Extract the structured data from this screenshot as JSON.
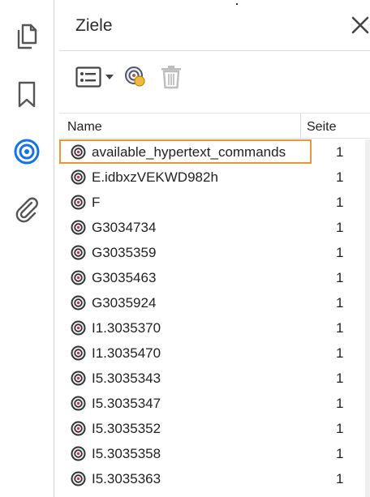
{
  "panel": {
    "title": "Ziele"
  },
  "rail": {
    "items": [
      {
        "icon": "pages-icon"
      },
      {
        "icon": "bookmark-icon"
      },
      {
        "icon": "destinations-icon",
        "active": true
      },
      {
        "icon": "attachment-icon"
      }
    ],
    "accent": "#1473e6"
  },
  "list": {
    "col_name": "Name",
    "col_page": "Seite",
    "rows": [
      {
        "name": "available_hypertext_commands",
        "page": "1"
      },
      {
        "name": "E.idbxzVEKWD982h",
        "page": "1"
      },
      {
        "name": "F",
        "page": "1"
      },
      {
        "name": "G3034734",
        "page": "1"
      },
      {
        "name": "G3035359",
        "page": "1"
      },
      {
        "name": "G3035463",
        "page": "1"
      },
      {
        "name": "G3035924",
        "page": "1"
      },
      {
        "name": "I1.3035370",
        "page": "1"
      },
      {
        "name": "I1.3035470",
        "page": "1"
      },
      {
        "name": "I5.3035343",
        "page": "1"
      },
      {
        "name": "I5.3035347",
        "page": "1"
      },
      {
        "name": "I5.3035352",
        "page": "1"
      },
      {
        "name": "I5.3035358",
        "page": "1"
      },
      {
        "name": "I5.3035363",
        "page": "1"
      }
    ],
    "selected_index": 0,
    "selection_color": "#e8963a"
  }
}
